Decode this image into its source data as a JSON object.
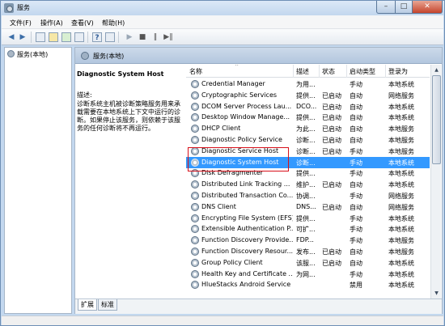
{
  "window": {
    "title": "服务",
    "min_label": "–",
    "max_label": "□",
    "close_label": "✕"
  },
  "menu": [
    "文件(F)",
    "操作(A)",
    "查看(V)",
    "帮助(H)"
  ],
  "toolbar": {
    "back": "◀",
    "forward": "▶",
    "help": "?",
    "play": "▶",
    "stop": "■",
    "pause": "‖",
    "restart": "▶‖"
  },
  "tree": {
    "item": "服务(本地)"
  },
  "pane": {
    "header": "服务(本地)",
    "selected_title": "Diagnostic System Host",
    "desc_label": "描述:",
    "desc_text": "诊断系统主机被诊断策略服务用来承载需要在本地系统上下文中运行的诊断。如果停止该服务，则依赖于该服务的任何诊断将不再运行。"
  },
  "columns": {
    "name": "名称",
    "desc": "描述",
    "status": "状态",
    "startup": "启动类型",
    "logon": "登录为"
  },
  "services": [
    {
      "name": "Credential Manager",
      "desc": "为用...",
      "status": "",
      "startup": "手动",
      "logon": "本地系统"
    },
    {
      "name": "Cryptographic Services",
      "desc": "提供...",
      "status": "已启动",
      "startup": "自动",
      "logon": "网络服务"
    },
    {
      "name": "DCOM Server Process Lau...",
      "desc": "DCO...",
      "status": "已启动",
      "startup": "自动",
      "logon": "本地系统"
    },
    {
      "name": "Desktop Window Manage...",
      "desc": "提供...",
      "status": "已启动",
      "startup": "自动",
      "logon": "本地系统"
    },
    {
      "name": "DHCP Client",
      "desc": "为此...",
      "status": "已启动",
      "startup": "自动",
      "logon": "本地服务"
    },
    {
      "name": "Diagnostic Policy Service",
      "desc": "诊断...",
      "status": "已启动",
      "startup": "自动",
      "logon": "本地服务"
    },
    {
      "name": "Diagnostic Service Host",
      "desc": "诊断...",
      "status": "已启动",
      "startup": "手动",
      "logon": "本地服务"
    },
    {
      "name": "Diagnostic System Host",
      "desc": "诊断...",
      "status": "",
      "startup": "手动",
      "logon": "本地系统",
      "selected": true
    },
    {
      "name": "Disk Defragmenter",
      "desc": "提供...",
      "status": "",
      "startup": "手动",
      "logon": "本地系统"
    },
    {
      "name": "Distributed Link Tracking ...",
      "desc": "维护...",
      "status": "已启动",
      "startup": "自动",
      "logon": "本地系统"
    },
    {
      "name": "Distributed Transaction Co...",
      "desc": "协调...",
      "status": "",
      "startup": "手动",
      "logon": "网络服务"
    },
    {
      "name": "DNS Client",
      "desc": "DNS...",
      "status": "已启动",
      "startup": "自动",
      "logon": "网络服务"
    },
    {
      "name": "Encrypting File System (EFS)",
      "desc": "提供...",
      "status": "",
      "startup": "手动",
      "logon": "本地系统"
    },
    {
      "name": "Extensible Authentication P...",
      "desc": "可扩...",
      "status": "",
      "startup": "手动",
      "logon": "本地系统"
    },
    {
      "name": "Function Discovery Provide...",
      "desc": "FDP...",
      "status": "",
      "startup": "手动",
      "logon": "本地服务"
    },
    {
      "name": "Function Discovery Resour...",
      "desc": "发布...",
      "status": "已启动",
      "startup": "自动",
      "logon": "本地服务"
    },
    {
      "name": "Group Policy Client",
      "desc": "该服...",
      "status": "已启动",
      "startup": "自动",
      "logon": "本地系统"
    },
    {
      "name": "Health Key and Certificate ...",
      "desc": "为网...",
      "status": "",
      "startup": "手动",
      "logon": "本地系统"
    },
    {
      "name": "HlueStacks Android Service",
      "desc": "",
      "status": "",
      "startup": "禁用",
      "logon": "本地系统"
    }
  ],
  "tabs": [
    "扩展",
    "标准"
  ]
}
